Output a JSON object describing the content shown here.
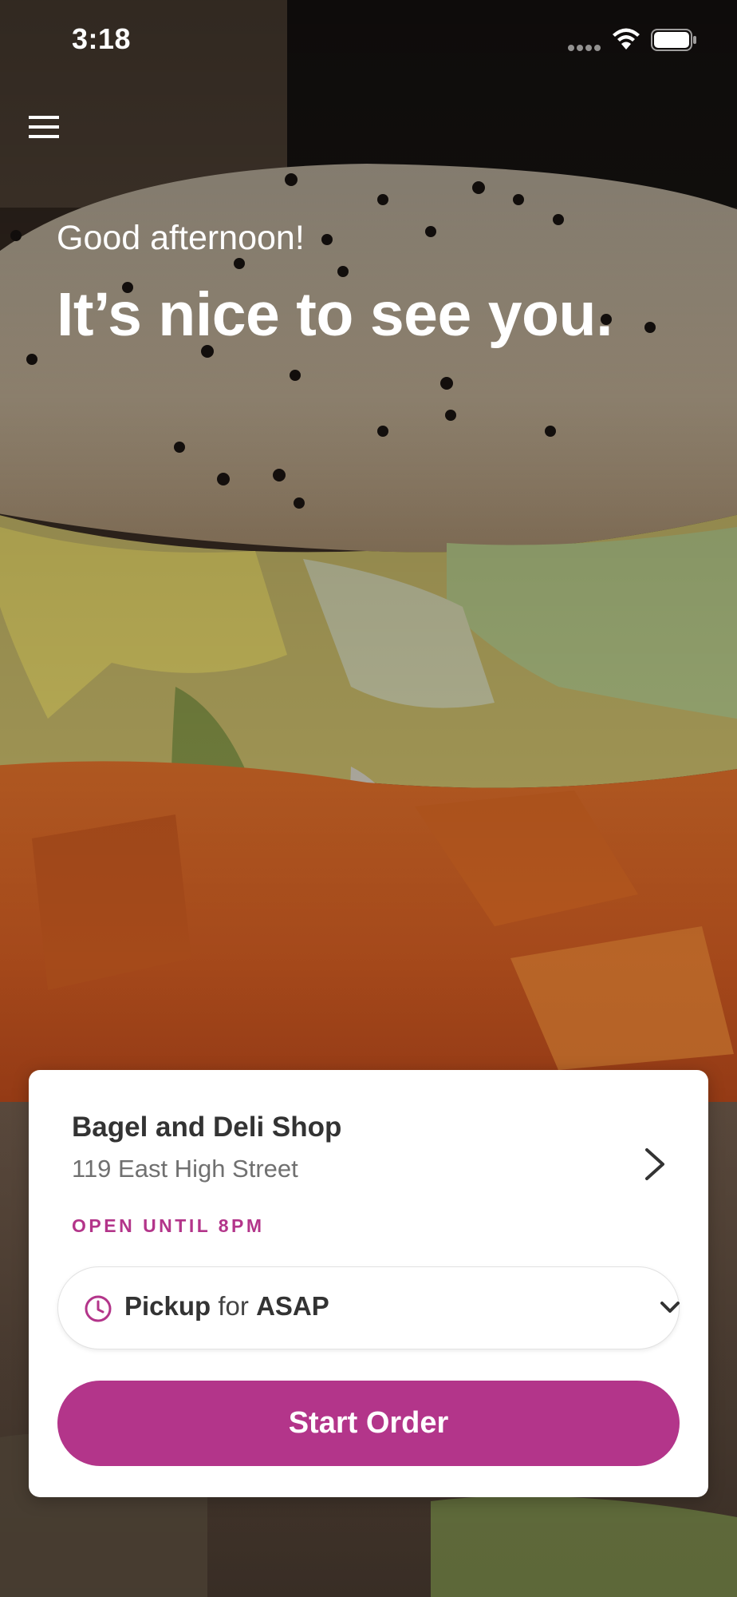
{
  "status_bar": {
    "time": "3:18"
  },
  "icons": {
    "menu": "hamburger-menu-icon",
    "wifi": "wifi-icon",
    "battery": "battery-icon",
    "signal": "cellular-signal-icon",
    "clock": "clock-icon",
    "store_chevron": "chevron-right-icon",
    "dropdown": "chevron-down-icon"
  },
  "greeting": {
    "small": "Good afternoon!",
    "large": "It’s nice to see you."
  },
  "store": {
    "name": "Bagel and Deli Shop",
    "address": "119 East High Street",
    "hours": "OPEN UNTIL 8PM"
  },
  "order_mode": {
    "mode": "Pickup",
    "connector": "for",
    "time": "ASAP"
  },
  "start_order_label": "Start Order",
  "colors": {
    "accent": "#b3358a",
    "card_bg": "#ffffff",
    "text_dark": "#333333",
    "text_muted": "#707070"
  }
}
